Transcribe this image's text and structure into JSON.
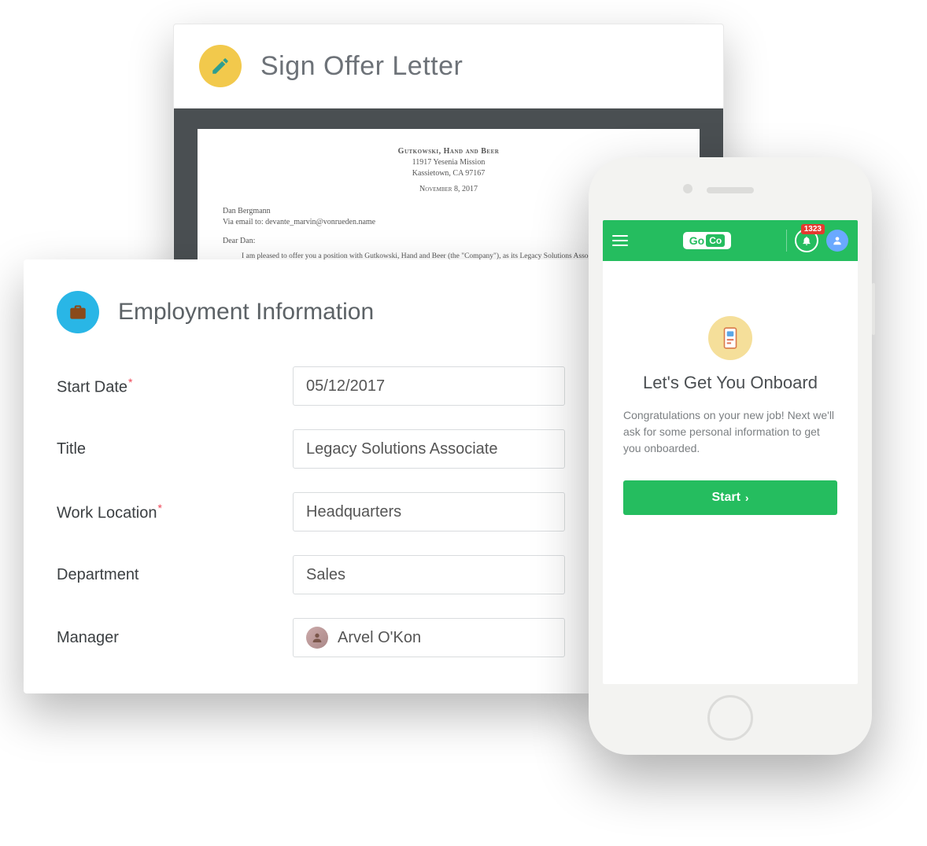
{
  "offer": {
    "title": "Sign Offer Letter",
    "letter": {
      "company_name": "Gutkowski, Hand and Beer",
      "address_line1": "11917 Yesenia Mission",
      "address_line2": "Kassietown, CA 97167",
      "date": "November 8, 2017",
      "recipient": "Dan Bergmann",
      "via_line": "Via email to: devante_marvin@vonrueden.name",
      "salutation": "Dear Dan:",
      "body": "I am pleased to offer you a position with Gutkowski, Hand and Beer (the \"Company\"), as its Legacy Solutions Associate. If you decide to join us, you will receive an annual salary of"
    }
  },
  "employment": {
    "title": "Employment Information",
    "fields": {
      "start_date": {
        "label": "Start Date",
        "value": "05/12/2017",
        "required": true
      },
      "title": {
        "label": "Title",
        "value": "Legacy Solutions Associate",
        "required": false
      },
      "work_location": {
        "label": "Work Location",
        "value": "Headquarters",
        "required": true
      },
      "department": {
        "label": "Department",
        "value": "Sales",
        "required": false
      },
      "manager": {
        "label": "Manager",
        "value": "Arvel O'Kon",
        "required": false
      }
    }
  },
  "phone": {
    "brand": {
      "go": "Go",
      "co": "Co"
    },
    "notification_count": "1323",
    "onboard": {
      "heading": "Let's Get You Onboard",
      "body": "Congratulations on your new job! Next we'll ask for some personal information to get you onboarded.",
      "start_label": "Start"
    }
  }
}
